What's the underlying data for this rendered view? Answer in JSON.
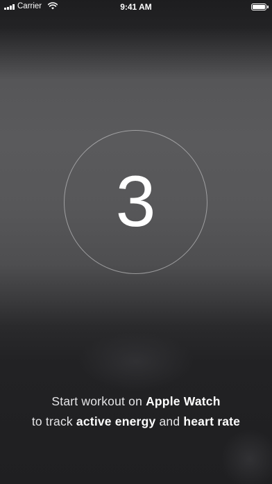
{
  "status_bar": {
    "carrier": "Carrier",
    "time": "9:41 AM",
    "battery_level": 1.0
  },
  "countdown": {
    "value": "3"
  },
  "instruction": {
    "part1": "Start workout on ",
    "apple_watch": "Apple Watch",
    "part2": "to track ",
    "active_energy": "active energy",
    "part3": " and ",
    "heart_rate": "heart rate"
  },
  "colors": {
    "background": "#1f1f21",
    "text": "#ffffff",
    "ring": "#dcdcde"
  }
}
